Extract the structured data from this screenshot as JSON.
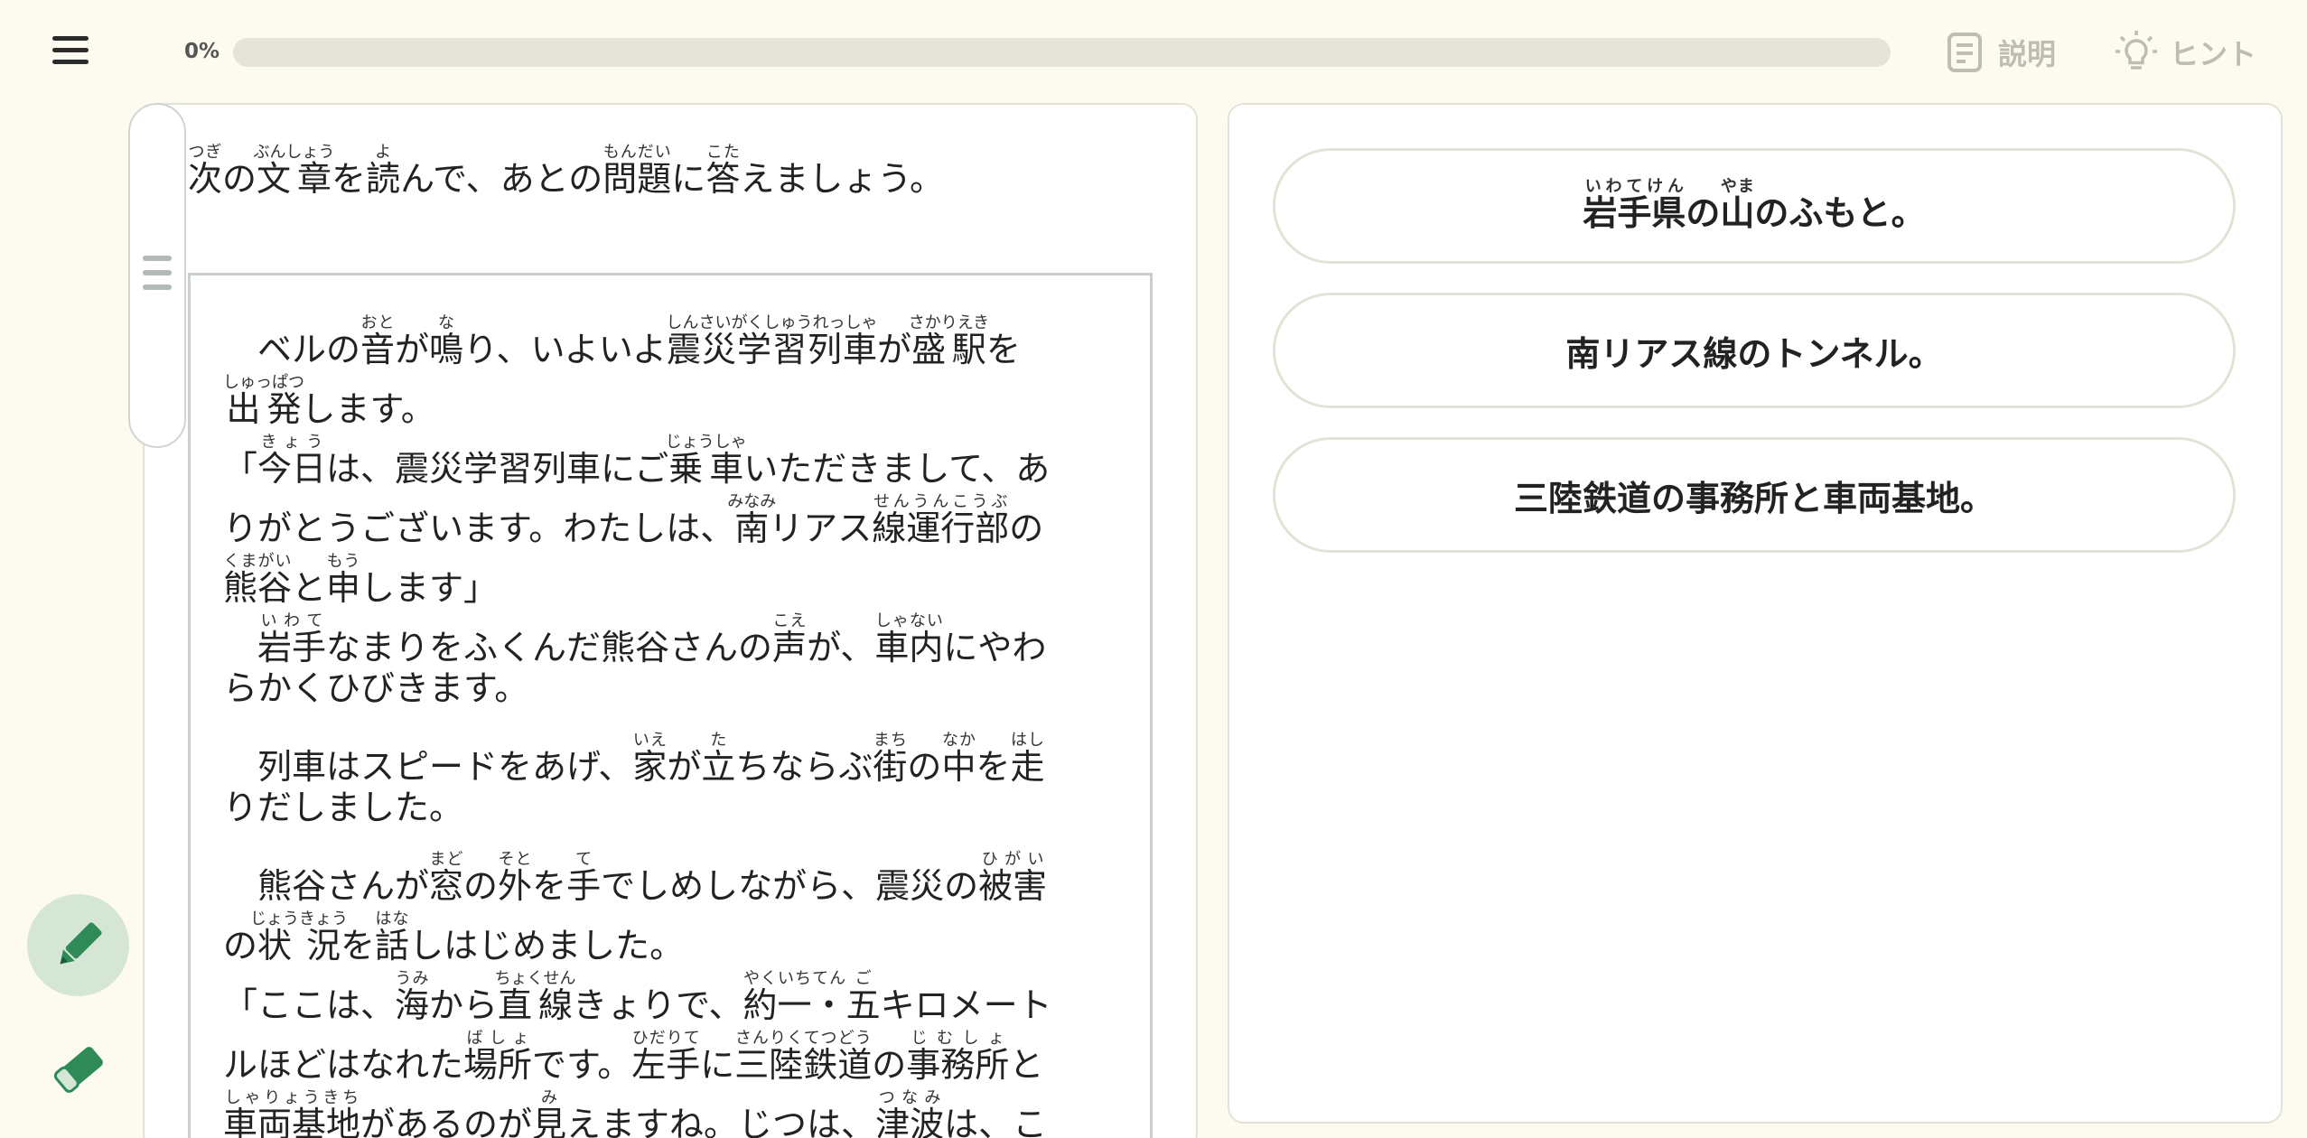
{
  "header": {
    "progress_label": "0%",
    "progress_value": 0,
    "explanation_label": "説明",
    "hint_label": "ヒント"
  },
  "instruction": [
    [
      "次",
      "つぎ"
    ],
    [
      "の",
      ""
    ],
    [
      "文章",
      "ぶんしょう"
    ],
    [
      "を",
      ""
    ],
    [
      "読",
      "よ"
    ],
    [
      "んで、あとの",
      ""
    ],
    [
      "問題",
      "もんだい"
    ],
    [
      "に",
      ""
    ],
    [
      "答",
      "こた"
    ],
    [
      "えましょう。",
      ""
    ]
  ],
  "passage": [
    [
      [
        "　ベルの",
        ""
      ],
      [
        "音",
        "おと"
      ],
      [
        "が",
        ""
      ],
      [
        "鳴",
        "な"
      ],
      [
        "り、いよいよ",
        ""
      ],
      [
        "震災学習列車",
        "しんさいがくしゅうれっしゃ"
      ],
      [
        "が",
        ""
      ],
      [
        "盛駅",
        "さかりえき"
      ],
      [
        "を",
        ""
      ]
    ],
    [
      [
        "出発",
        "しゅっぱつ"
      ],
      [
        "します。",
        ""
      ]
    ],
    [
      [
        "「",
        ""
      ],
      [
        "今日",
        "きょう"
      ],
      [
        "は、震災学習列車にご",
        ""
      ],
      [
        "乗車",
        "じょうしゃ"
      ],
      [
        "いただきまして、あ",
        ""
      ]
    ],
    [
      [
        "りがとうございます。わたしは、",
        ""
      ],
      [
        "南",
        "みなみ"
      ],
      [
        "リアス",
        ""
      ],
      [
        "線運行部",
        "せんうんこうぶ"
      ],
      [
        "の",
        ""
      ]
    ],
    [
      [
        "熊谷",
        "くまがい"
      ],
      [
        "と",
        ""
      ],
      [
        "申",
        "もう"
      ],
      [
        "します」",
        ""
      ]
    ],
    [
      [
        "　",
        ""
      ],
      [
        "岩手",
        "いわて"
      ],
      [
        "なまりをふくんだ熊谷さんの",
        ""
      ],
      [
        "声",
        "こえ"
      ],
      [
        "が、",
        ""
      ],
      [
        "車内",
        "しゃない"
      ],
      [
        "にやわ",
        ""
      ]
    ],
    [
      [
        "らかくひびきます。",
        ""
      ]
    ],
    [
      [
        "　列車はスピードをあげ、",
        ""
      ],
      [
        "家",
        "いえ"
      ],
      [
        "が",
        ""
      ],
      [
        "立",
        "た"
      ],
      [
        "ちならぶ",
        ""
      ],
      [
        "街",
        "まち"
      ],
      [
        "の",
        ""
      ],
      [
        "中",
        "なか"
      ],
      [
        "を",
        ""
      ],
      [
        "走",
        "はし"
      ]
    ],
    [
      [
        "りだしました。",
        ""
      ]
    ],
    [
      [
        "　熊谷さんが",
        ""
      ],
      [
        "窓",
        "まど"
      ],
      [
        "の",
        ""
      ],
      [
        "外",
        "そと"
      ],
      [
        "を",
        ""
      ],
      [
        "手",
        "て"
      ],
      [
        "でしめしながら、震災の",
        ""
      ],
      [
        "被害",
        "ひがい"
      ]
    ],
    [
      [
        "の",
        ""
      ],
      [
        "状況",
        "じょうきょう"
      ],
      [
        "を",
        ""
      ],
      [
        "話",
        "はな"
      ],
      [
        "しはじめました。",
        ""
      ]
    ],
    [
      [
        "「ここは、",
        ""
      ],
      [
        "海",
        "うみ"
      ],
      [
        "から",
        ""
      ],
      [
        "直線",
        "ちょくせん"
      ],
      [
        "きょりで、",
        ""
      ],
      [
        "約一",
        "やくいち"
      ],
      [
        "・",
        "てん"
      ],
      [
        "五",
        "ご"
      ],
      [
        "キロメート",
        ""
      ]
    ],
    [
      [
        "ルほどはなれた",
        ""
      ],
      [
        "場所",
        "ばしょ"
      ],
      [
        "です。",
        ""
      ],
      [
        "左手",
        "ひだりて"
      ],
      [
        "に",
        ""
      ],
      [
        "三陸鉄道",
        "さんりくてつどう"
      ],
      [
        "の",
        ""
      ],
      [
        "事務所",
        "じむしょ"
      ],
      [
        "と",
        ""
      ]
    ],
    [
      [
        "車両基地",
        "しゃりょうきち"
      ],
      [
        "があるのが",
        ""
      ],
      [
        "見",
        "み"
      ],
      [
        "えますね。じつは、",
        ""
      ],
      [
        "津波",
        "つなみ"
      ],
      [
        "は、こ",
        ""
      ]
    ]
  ],
  "choices": [
    [
      [
        "岩手県",
        "いわてけん"
      ],
      [
        "の",
        ""
      ],
      [
        "山",
        "やま"
      ],
      [
        "のふもと。",
        ""
      ]
    ],
    [
      [
        "南リアス線のトンネル。",
        ""
      ]
    ],
    [
      [
        "三陸鉄道の事務所と車両基地。",
        ""
      ]
    ]
  ],
  "colors": {
    "background": "#fdfbef",
    "accent_green": "#2e8b57",
    "tool_bg": "#d6e6d6"
  }
}
